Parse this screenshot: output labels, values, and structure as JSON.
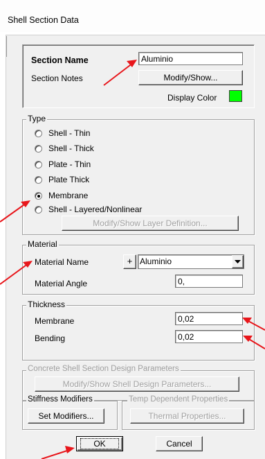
{
  "window": {
    "title": "Shell Section Data"
  },
  "section": {
    "name_label": "Section Name",
    "name_value": "Aluminio",
    "notes_label": "Section Notes",
    "notes_button": "Modify/Show...",
    "display_color_label": "Display Color",
    "display_color": "#00ff00"
  },
  "type": {
    "legend": "Type",
    "options": [
      {
        "label": "Shell - Thin",
        "selected": false
      },
      {
        "label": "Shell - Thick",
        "selected": false
      },
      {
        "label": "Plate - Thin",
        "selected": false
      },
      {
        "label": "Plate Thick",
        "selected": false
      },
      {
        "label": "Membrane",
        "selected": true
      },
      {
        "label": "Shell - Layered/Nonlinear",
        "selected": false
      }
    ],
    "layer_button": "Modify/Show Layer Definition..."
  },
  "material": {
    "legend": "Material",
    "name_label": "Material Name",
    "plus_label": "+",
    "name_value": "Aluminio",
    "angle_label": "Material Angle",
    "angle_value": "0,"
  },
  "thickness": {
    "legend": "Thickness",
    "membrane_label": "Membrane",
    "membrane_value": "0,02",
    "bending_label": "Bending",
    "bending_value": "0,02"
  },
  "concrete": {
    "legend": "Concrete Shell Section Design Parameters",
    "button": "Modify/Show Shell Design Parameters..."
  },
  "stiffness": {
    "legend": "Stiffness Modifiers",
    "button": "Set Modifiers..."
  },
  "temp": {
    "legend": "Temp Dependent Properties",
    "button": "Thermal Properties..."
  },
  "footer": {
    "ok": "OK",
    "cancel": "Cancel"
  },
  "colors": {
    "annotation_arrow": "#e8161b",
    "dialog_bg": "#f0f0f0"
  }
}
